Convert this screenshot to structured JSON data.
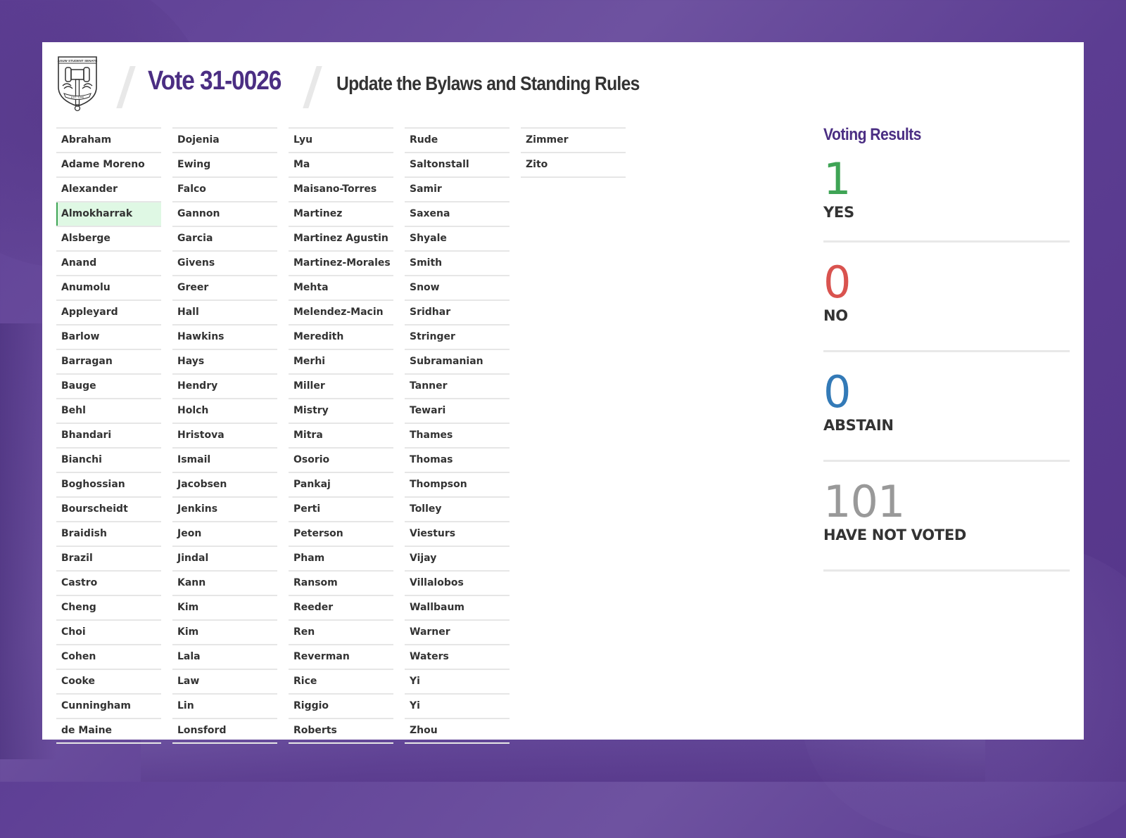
{
  "header": {
    "logo_top_text": "ASUW STUDENT SENATE",
    "logo_bottom_text": "EST. 1946",
    "vote_id": "Vote 31-0026",
    "subject": "Update the Bylaws and Standing Rules"
  },
  "colors": {
    "brand_purple": "#4b2e83",
    "yes": "#3fa455",
    "no": "#d9534f",
    "abstain": "#337ab7",
    "not_voted": "#999999",
    "yes_highlight": "#dff8e4"
  },
  "roster": {
    "columns": [
      [
        {
          "name": "Abraham",
          "status": "none"
        },
        {
          "name": "Adame Moreno",
          "status": "none"
        },
        {
          "name": "Alexander",
          "status": "none"
        },
        {
          "name": "Almokharrak",
          "status": "yes"
        },
        {
          "name": "Alsberge",
          "status": "none"
        },
        {
          "name": "Anand",
          "status": "none"
        },
        {
          "name": "Anumolu",
          "status": "none"
        },
        {
          "name": "Appleyard",
          "status": "none"
        },
        {
          "name": "Barlow",
          "status": "none"
        },
        {
          "name": "Barragan",
          "status": "none"
        },
        {
          "name": "Bauge",
          "status": "none"
        },
        {
          "name": "Behl",
          "status": "none"
        },
        {
          "name": "Bhandari",
          "status": "none"
        },
        {
          "name": "Bianchi",
          "status": "none"
        },
        {
          "name": "Boghossian",
          "status": "none"
        },
        {
          "name": "Bourscheidt",
          "status": "none"
        },
        {
          "name": "Braidish",
          "status": "none"
        },
        {
          "name": "Brazil",
          "status": "none"
        },
        {
          "name": "Castro",
          "status": "none"
        },
        {
          "name": "Cheng",
          "status": "none"
        },
        {
          "name": "Choi",
          "status": "none"
        },
        {
          "name": "Cohen",
          "status": "none"
        },
        {
          "name": "Cooke",
          "status": "none"
        },
        {
          "name": "Cunningham",
          "status": "none"
        },
        {
          "name": "de Maine",
          "status": "none"
        }
      ],
      [
        {
          "name": "Dojenia",
          "status": "none"
        },
        {
          "name": "Ewing",
          "status": "none"
        },
        {
          "name": "Falco",
          "status": "none"
        },
        {
          "name": "Gannon",
          "status": "none"
        },
        {
          "name": "Garcia",
          "status": "none"
        },
        {
          "name": "Givens",
          "status": "none"
        },
        {
          "name": "Greer",
          "status": "none"
        },
        {
          "name": "Hall",
          "status": "none"
        },
        {
          "name": "Hawkins",
          "status": "none"
        },
        {
          "name": "Hays",
          "status": "none"
        },
        {
          "name": "Hendry",
          "status": "none"
        },
        {
          "name": "Holch",
          "status": "none"
        },
        {
          "name": "Hristova",
          "status": "none"
        },
        {
          "name": "Ismail",
          "status": "none"
        },
        {
          "name": "Jacobsen",
          "status": "none"
        },
        {
          "name": "Jenkins",
          "status": "none"
        },
        {
          "name": "Jeon",
          "status": "none"
        },
        {
          "name": "Jindal",
          "status": "none"
        },
        {
          "name": "Kann",
          "status": "none"
        },
        {
          "name": "Kim",
          "status": "none"
        },
        {
          "name": "Kim",
          "status": "none"
        },
        {
          "name": "Lala",
          "status": "none"
        },
        {
          "name": "Law",
          "status": "none"
        },
        {
          "name": "Lin",
          "status": "none"
        },
        {
          "name": "Lonsford",
          "status": "none"
        }
      ],
      [
        {
          "name": "Lyu",
          "status": "none"
        },
        {
          "name": "Ma",
          "status": "none"
        },
        {
          "name": "Maisano-Torres",
          "status": "none"
        },
        {
          "name": "Martinez",
          "status": "none"
        },
        {
          "name": "Martinez Agustin",
          "status": "none"
        },
        {
          "name": "Martinez-Morales",
          "status": "none"
        },
        {
          "name": "Mehta",
          "status": "none"
        },
        {
          "name": "Melendez-Macin",
          "status": "none"
        },
        {
          "name": "Meredith",
          "status": "none"
        },
        {
          "name": "Merhi",
          "status": "none"
        },
        {
          "name": "Miller",
          "status": "none"
        },
        {
          "name": "Mistry",
          "status": "none"
        },
        {
          "name": "Mitra",
          "status": "none"
        },
        {
          "name": "Osorio",
          "status": "none"
        },
        {
          "name": "Pankaj",
          "status": "none"
        },
        {
          "name": "Perti",
          "status": "none"
        },
        {
          "name": "Peterson",
          "status": "none"
        },
        {
          "name": "Pham",
          "status": "none"
        },
        {
          "name": "Ransom",
          "status": "none"
        },
        {
          "name": "Reeder",
          "status": "none"
        },
        {
          "name": "Ren",
          "status": "none"
        },
        {
          "name": "Reverman",
          "status": "none"
        },
        {
          "name": "Rice",
          "status": "none"
        },
        {
          "name": "Riggio",
          "status": "none"
        },
        {
          "name": "Roberts",
          "status": "none"
        }
      ],
      [
        {
          "name": "Rude",
          "status": "none"
        },
        {
          "name": "Saltonstall",
          "status": "none"
        },
        {
          "name": "Samir",
          "status": "none"
        },
        {
          "name": "Saxena",
          "status": "none"
        },
        {
          "name": "Shyale",
          "status": "none"
        },
        {
          "name": "Smith",
          "status": "none"
        },
        {
          "name": "Snow",
          "status": "none"
        },
        {
          "name": "Sridhar",
          "status": "none"
        },
        {
          "name": "Stringer",
          "status": "none"
        },
        {
          "name": "Subramanian",
          "status": "none"
        },
        {
          "name": "Tanner",
          "status": "none"
        },
        {
          "name": "Tewari",
          "status": "none"
        },
        {
          "name": "Thames",
          "status": "none"
        },
        {
          "name": "Thomas",
          "status": "none"
        },
        {
          "name": "Thompson",
          "status": "none"
        },
        {
          "name": "Tolley",
          "status": "none"
        },
        {
          "name": "Viesturs",
          "status": "none"
        },
        {
          "name": "Vijay",
          "status": "none"
        },
        {
          "name": "Villalobos",
          "status": "none"
        },
        {
          "name": "Wallbaum",
          "status": "none"
        },
        {
          "name": "Warner",
          "status": "none"
        },
        {
          "name": "Waters",
          "status": "none"
        },
        {
          "name": "Yi",
          "status": "none"
        },
        {
          "name": "Yi",
          "status": "none"
        },
        {
          "name": "Zhou",
          "status": "none"
        }
      ],
      [
        {
          "name": "Zimmer",
          "status": "none"
        },
        {
          "name": "Zito",
          "status": "none"
        }
      ]
    ]
  },
  "results": {
    "title": "Voting Results",
    "tallies": [
      {
        "key": "yes",
        "count": "1",
        "label": "YES",
        "color": "#3fa455"
      },
      {
        "key": "no",
        "count": "0",
        "label": "NO",
        "color": "#d9534f"
      },
      {
        "key": "abstain",
        "count": "0",
        "label": "ABSTAIN",
        "color": "#337ab7"
      },
      {
        "key": "not_voted",
        "count": "101",
        "label": "HAVE NOT VOTED",
        "color": "#999999"
      }
    ]
  }
}
